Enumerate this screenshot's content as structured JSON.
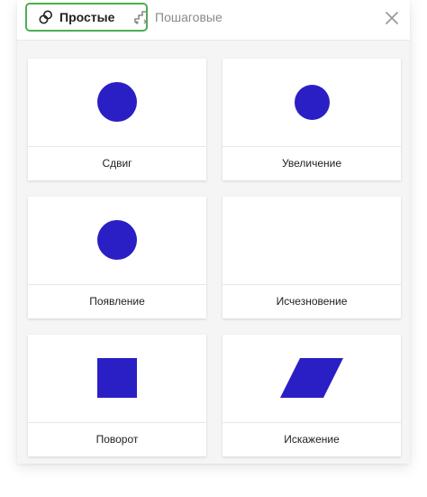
{
  "tabs": {
    "simple_label": "Простые",
    "step_label": "Пошаговые"
  },
  "cards": [
    {
      "label": "Сдвиг",
      "shape": "circle"
    },
    {
      "label": "Увеличение",
      "shape": "circle-small"
    },
    {
      "label": "Появление",
      "shape": "circle"
    },
    {
      "label": "Исчезновение",
      "shape": "none"
    },
    {
      "label": "Поворот",
      "shape": "square"
    },
    {
      "label": "Искажение",
      "shape": "parallelogram"
    }
  ],
  "colors": {
    "shape": "#2a1fc4",
    "active_tab_border": "#4caf50"
  },
  "icons": {
    "simple_tab": "link-circles-icon",
    "step_tab": "steps-icon",
    "close": "close-icon"
  }
}
